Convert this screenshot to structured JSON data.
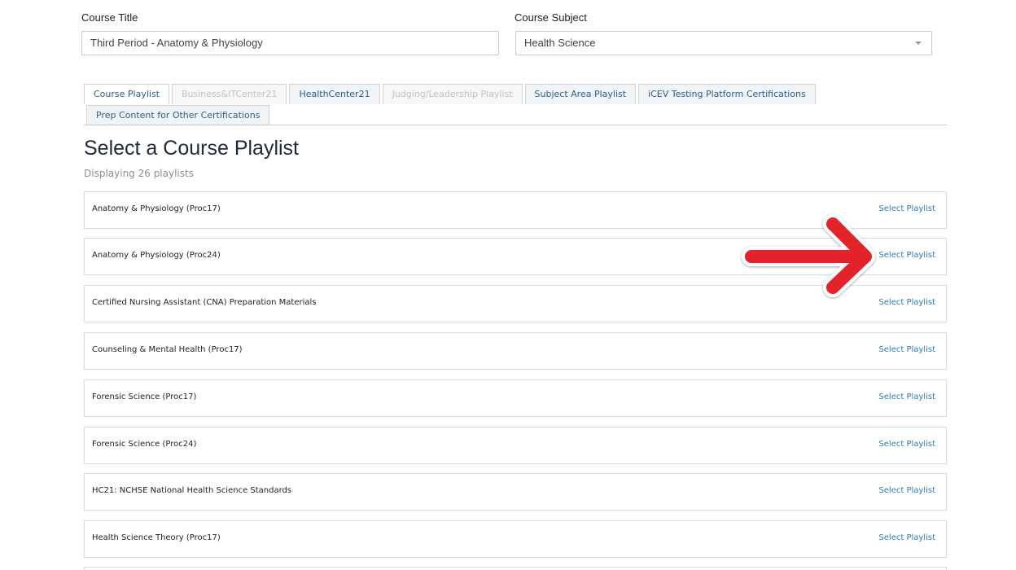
{
  "form": {
    "course_title_label": "Course Title",
    "course_title_value": "Third Period - Anatomy & Physiology",
    "course_subject_label": "Course Subject",
    "course_subject_value": "Health Science"
  },
  "tabs": [
    {
      "label": "Course Playlist",
      "state": "active"
    },
    {
      "label": "Business&ITCenter21",
      "state": "disabled"
    },
    {
      "label": "HealthCenter21",
      "state": "normal"
    },
    {
      "label": "Judging/Leadership Playlist",
      "state": "disabled"
    },
    {
      "label": "Subject Area Playlist",
      "state": "normal"
    },
    {
      "label": "iCEV Testing Platform Certifications",
      "state": "normal"
    },
    {
      "label": "Prep Content for Other Certifications",
      "state": "normal"
    }
  ],
  "main": {
    "title": "Select a Course Playlist",
    "count_text": "Displaying 26 playlists",
    "action_label": "Select Playlist"
  },
  "playlists": [
    "Anatomy & Physiology (Proc17)",
    "Anatomy & Physiology (Proc24)",
    "Certified Nursing Assistant (CNA) Preparation Materials",
    "Counseling & Mental Health (Proc17)",
    "Forensic Science (Proc17)",
    "Forensic Science (Proc24)",
    "HC21: NCHSE National Health Science Standards",
    "Health Science Theory (Proc17)"
  ],
  "annotation": {
    "arrow_icon": "red-arrow-icon",
    "arrow_color": "#e3202b"
  }
}
